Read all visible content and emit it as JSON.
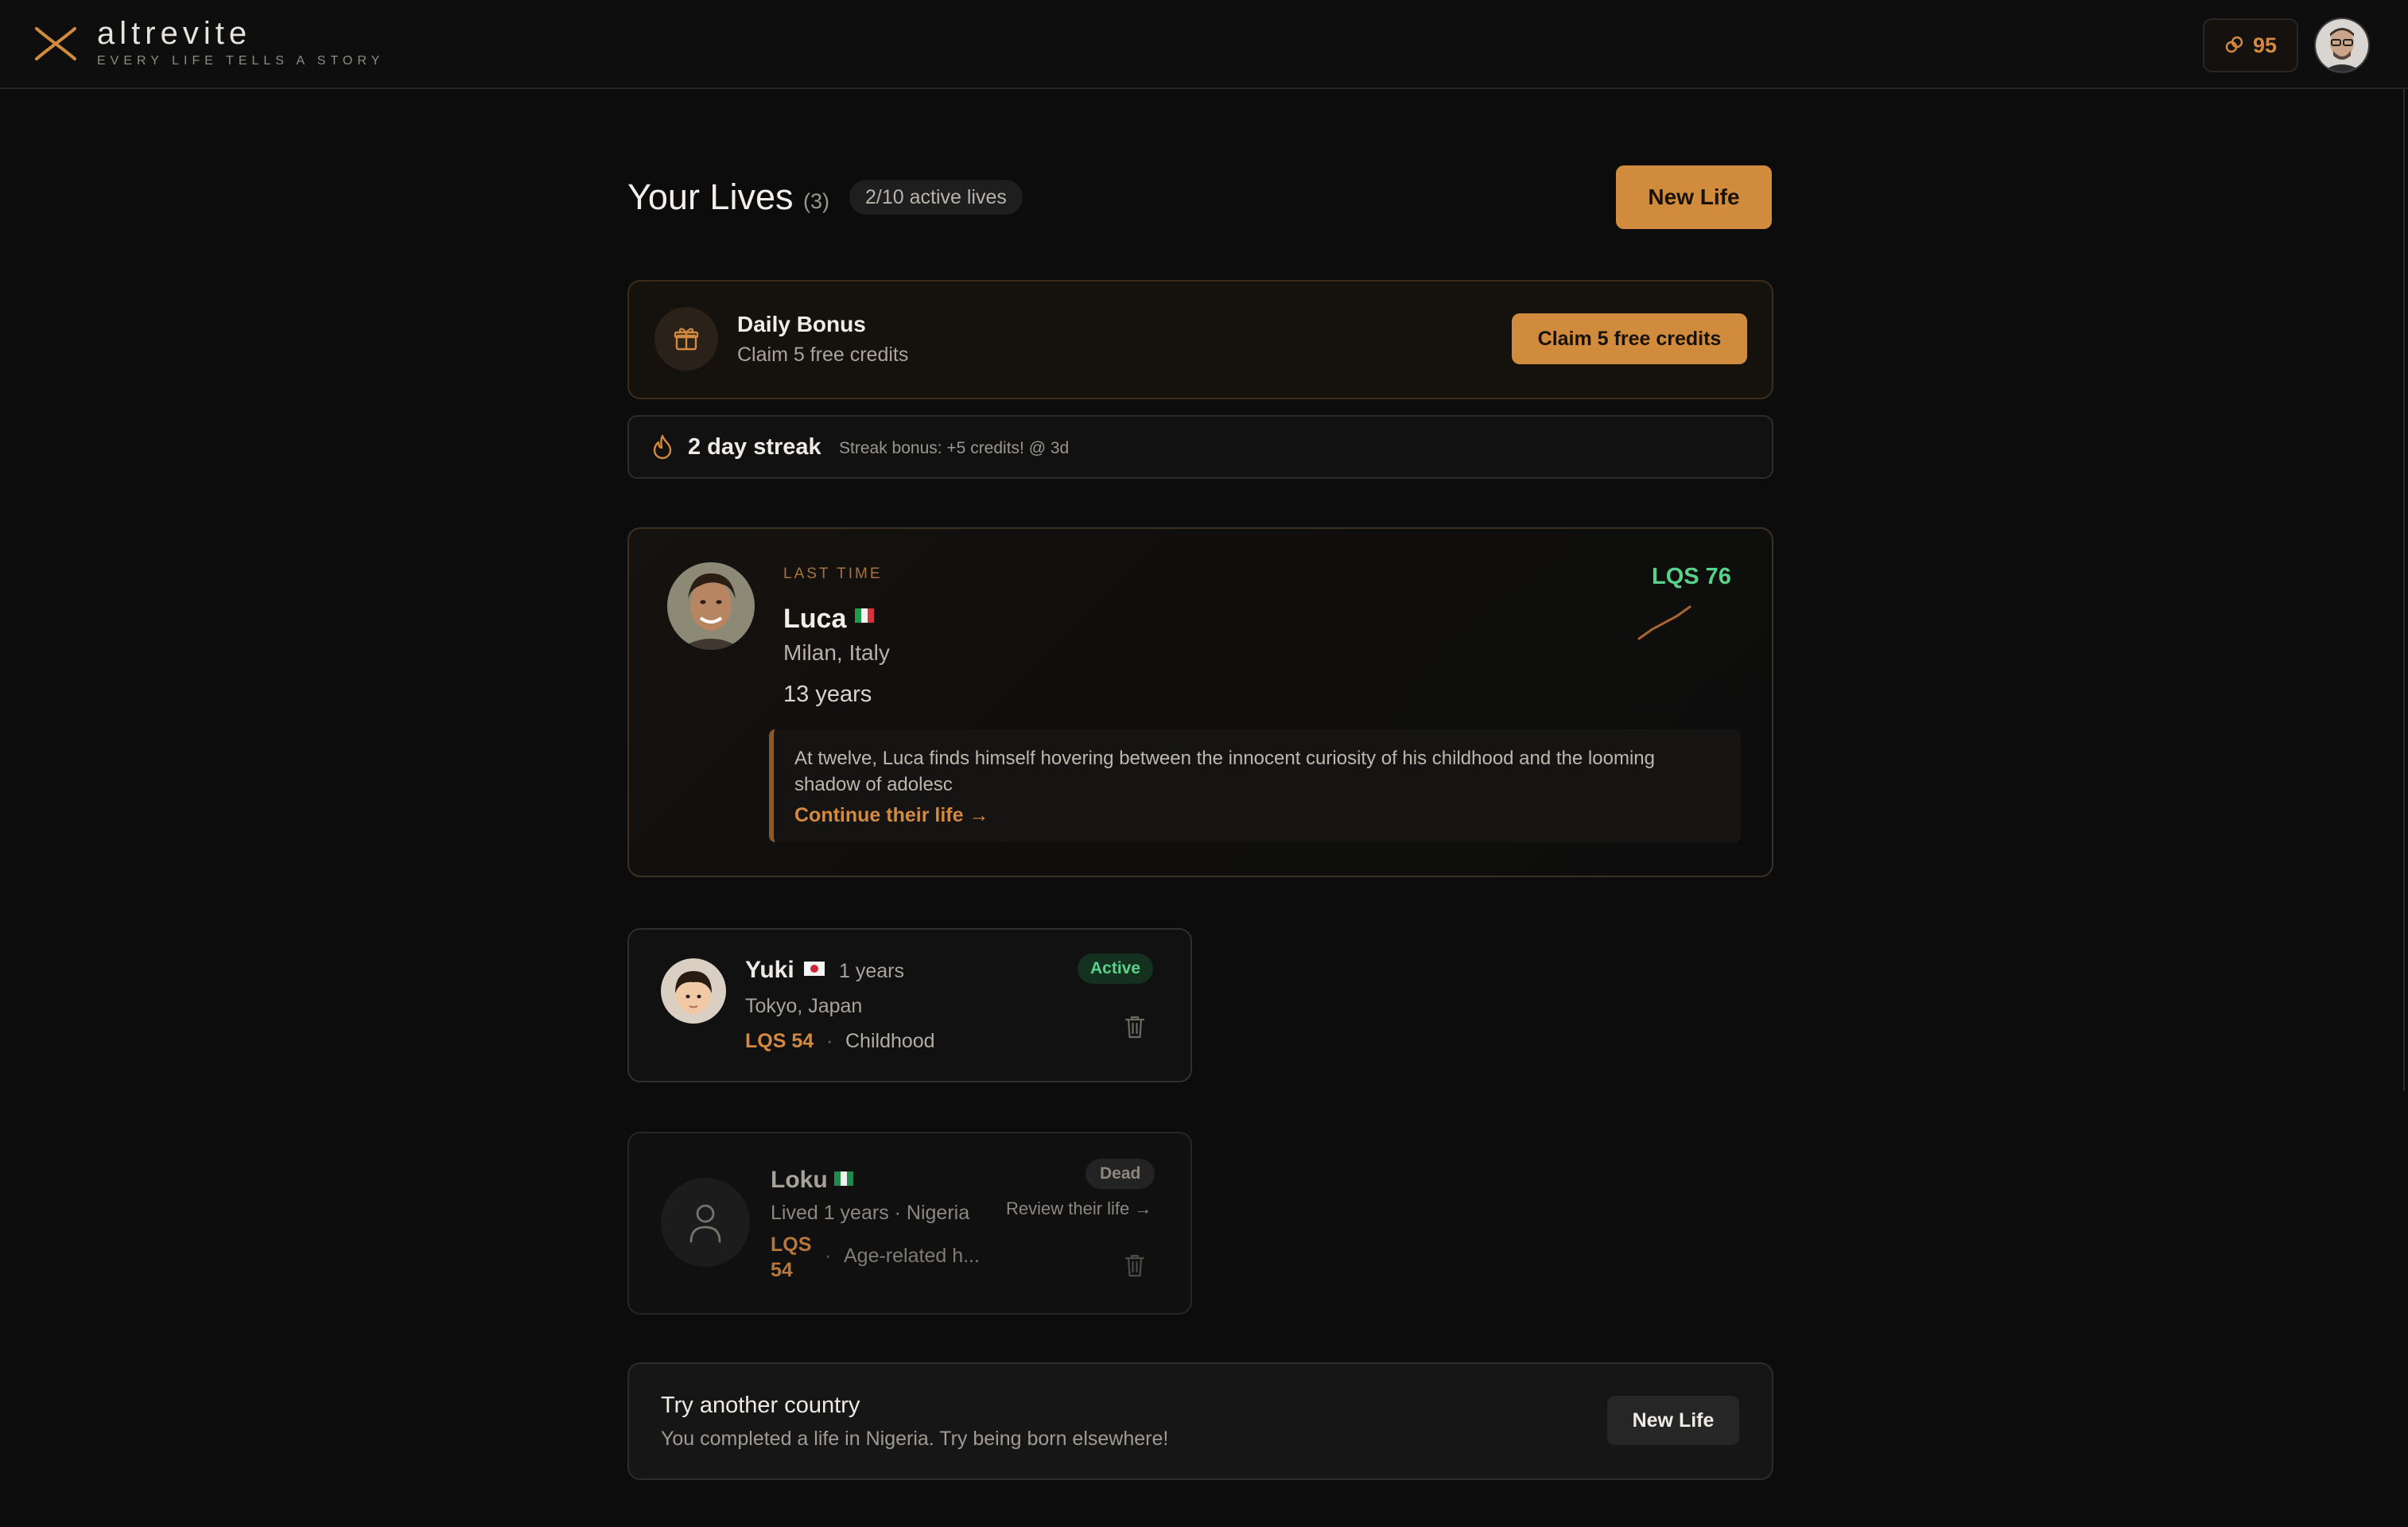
{
  "brand": {
    "name": "altrevite",
    "tagline": "EVERY LIFE TELLS A STORY"
  },
  "header": {
    "credits": "95"
  },
  "page": {
    "title": "Your Lives",
    "count": "(3)",
    "active_lives": "2/10 active lives",
    "new_life_label": "New Life"
  },
  "daily_bonus": {
    "title": "Daily Bonus",
    "subtitle": "Claim 5 free credits",
    "button": "Claim 5 free credits"
  },
  "streak": {
    "title": "2 day streak",
    "note": "Streak bonus: +5 credits! @ 3d"
  },
  "last_life": {
    "label": "LAST TIME",
    "name": "Luca",
    "place": "Milan, Italy",
    "age": "13 years",
    "lqs": "LQS 76",
    "story": "At twelve, Luca finds himself hovering between the innocent curiosity of his childhood and the looming shadow of adolesc",
    "continue": "Continue their life →",
    "lqs_trend": [
      62,
      66,
      69,
      72,
      76
    ]
  },
  "lives": [
    {
      "name": "Yuki",
      "age": "1 years",
      "place": "Tokyo, Japan",
      "lqs": "LQS 54",
      "stage": "Childhood",
      "status": "Active"
    },
    {
      "name": "Loku",
      "info": "Lived 1 years · Nigeria",
      "lqs": "LQS 54",
      "cause": "Age-related h...",
      "status": "Dead",
      "review": "Review their life →"
    }
  ],
  "suggestion": {
    "title": "Try another country",
    "subtitle": "You completed a life in Nigeria. Try being born elsewhere!",
    "button": "New Life"
  },
  "colors": {
    "accent": "#d18b3d",
    "positive": "#58d28b",
    "background": "#0c0c0c"
  }
}
